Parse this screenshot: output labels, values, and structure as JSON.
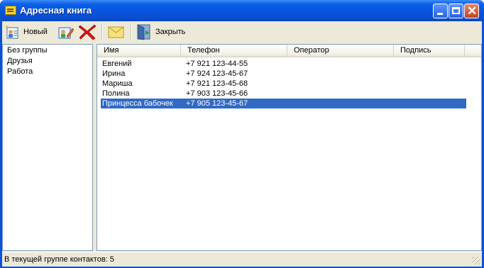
{
  "window": {
    "title": "Адресная книга"
  },
  "toolbar": {
    "new_label": "Новый",
    "close_label": "Закрыть"
  },
  "groups": [
    "Без группы",
    "Друзья",
    "Работа"
  ],
  "selected_group": "Друзья",
  "columns": {
    "name": "Имя",
    "phone": "Телефон",
    "operator": "Оператор",
    "signature": "Подпись"
  },
  "contacts": [
    {
      "name": "Евгений",
      "phone": "+7 921 123-44-55",
      "operator": "",
      "signature": ""
    },
    {
      "name": "Ирина",
      "phone": "+7 924 123-45-67",
      "operator": "",
      "signature": ""
    },
    {
      "name": "Мариша",
      "phone": "+7 921 123-45-68",
      "operator": "",
      "signature": ""
    },
    {
      "name": "Полина",
      "phone": "+7 903 123-45-66",
      "operator": "",
      "signature": ""
    },
    {
      "name": "Принцесса бабочек",
      "phone": "+7 905 123-45-67",
      "operator": "",
      "signature": ""
    }
  ],
  "selected_contact": "Принцесса бабочек",
  "status": {
    "text": "В текущей группе контактов: 5"
  },
  "icons": [
    "address-book-icon",
    "new-contact-icon",
    "edit-contact-icon",
    "delete-icon",
    "mail-icon",
    "exit-door-icon",
    "minimize-icon",
    "maximize-icon",
    "close-icon",
    "resize-grip-icon"
  ]
}
